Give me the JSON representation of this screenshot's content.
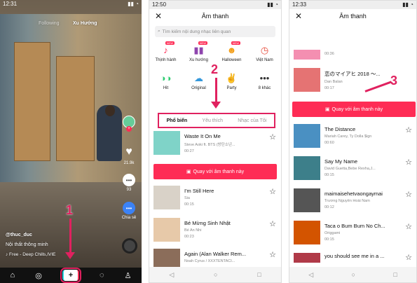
{
  "panel1": {
    "status_time": "12:31",
    "tabs": {
      "following": "Following",
      "for_you": "Xu Hướng"
    },
    "side": {
      "likes": "21.9k",
      "comments": "93",
      "share_label": "Chia sẻ"
    },
    "username": "@thuc_duc",
    "caption": "Nội thất thông minh",
    "music": "♪ Free - Deep Chills,IVIE",
    "annotation": "1",
    "nav": {
      "home": "⌂",
      "discover": "◎",
      "add": "+",
      "inbox": "◌",
      "profile": "♙"
    }
  },
  "panel2": {
    "status_time": "12:50",
    "title": "Âm thanh",
    "search_placeholder": "Tìm kiếm nội dung nhạc liên quan",
    "categories": [
      {
        "label": "Thịnh hành",
        "icon": "♪",
        "new": "NEW",
        "color": "#fe2c55"
      },
      {
        "label": "Xu hướng",
        "icon": "▮▮",
        "new": "NEW",
        "color": "#8e44ad"
      },
      {
        "label": "Halloween",
        "icon": "☻",
        "new": "NEW",
        "color": "#f39c12"
      },
      {
        "label": "Việt Nam",
        "icon": "◷",
        "new": "",
        "color": "#e74c3c"
      },
      {
        "label": "Hit",
        "icon": "◑◑",
        "new": "",
        "color": "#2ecc71"
      },
      {
        "label": "Original",
        "icon": "☁",
        "new": "",
        "color": "#3498db"
      },
      {
        "label": "Party",
        "icon": "✌",
        "new": "",
        "color": "#2980b9"
      },
      {
        "label": "8 khác",
        "icon": "•••",
        "new": "",
        "color": "#333333"
      }
    ],
    "tabs": {
      "popular": "Phổ biến",
      "favorites": "Yêu thích",
      "mine": "Nhạc của Tôi"
    },
    "songs": [
      {
        "title": "Waste It On Me",
        "artist": "Steve Aoki ft. BTS (방탄소년...",
        "duration": "00:27"
      },
      {
        "title": "I'm Still Here",
        "artist": "Sia",
        "duration": "00:15"
      },
      {
        "title": "Bé Mừng Sinh Nhật",
        "artist": "Bé An Nhi",
        "duration": "00:23"
      },
      {
        "title": "Again (Alan Walker Rem...",
        "artist": "Noah Cyrus / XXXTENTACI...",
        "duration": ""
      }
    ],
    "record_button": "Quay với âm thanh này",
    "annotation": "2"
  },
  "panel3": {
    "status_time": "12:33",
    "title": "Âm thanh",
    "top_duration": "00:36",
    "songs": [
      {
        "title": "恋のマイアヒ 2018 〜...",
        "artist": "Dan Balan",
        "duration": "00:17"
      },
      {
        "title": "The Distance",
        "artist": "Mariah Carey, Ty Dolla $ign",
        "duration": "00:60"
      },
      {
        "title": "Say My Name",
        "artist": "David Guetta,Bebe Rexha,J...",
        "duration": "00:15"
      },
      {
        "title": "maimaisehetvaongaymai",
        "artist": "Trương Nguyễn Hoài Nam",
        "duration": "00:12"
      },
      {
        "title": "Taca o Bum Bum No Ch...",
        "artist": "Origgami",
        "duration": "00:15"
      },
      {
        "title": "you should see me in a ...",
        "artist": "",
        "duration": ""
      }
    ],
    "record_button": "Quay với âm thanh này",
    "annotation": "3"
  }
}
